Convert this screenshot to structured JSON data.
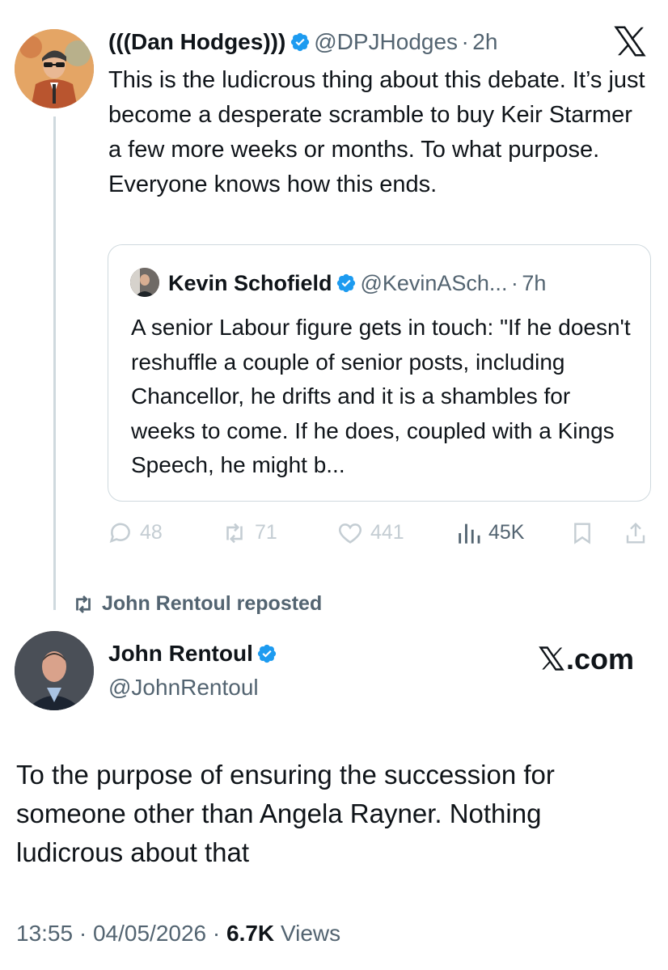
{
  "original_tweet": {
    "author_name": "(((Dan Hodges)))",
    "handle": "@DPJHodges",
    "separator": "·",
    "time_ago": "2h",
    "text": "This is the ludicrous thing about this debate. It’s just become a desperate scramble to buy Keir Starmer a few more weeks or months. To what purpose. Everyone knows how this ends.",
    "quoted_tweet": {
      "author_name": "Kevin Schofield",
      "handle": "@KevinASch...",
      "separator": "·",
      "time_ago": "7h",
      "text": "A senior Labour figure gets in touch: \"If he doesn't reshuffle a couple of senior posts, including Chancellor, he drifts and it is a shambles for weeks to come. If he does, coupled with a Kings Speech, he might b..."
    },
    "actions": {
      "replies": "48",
      "reposts": "71",
      "likes": "441",
      "views": "45K"
    }
  },
  "repost_banner": {
    "text": "John Rentoul reposted"
  },
  "reply_tweet": {
    "author_name": "John Rentoul",
    "handle": "@JohnRentoul",
    "brand": ".com",
    "text": "To the purpose of ensuring the succession for someone other than Angela Rayner. Nothing ludicrous about that",
    "time": "13:55",
    "date": "04/05/2026",
    "views_count": "6.7K",
    "views_label": "Views"
  },
  "icons": {
    "verified": "verified-badge-icon",
    "x_logo": "x-logo-icon",
    "reply": "reply-icon",
    "repost": "repost-icon",
    "like": "heart-icon",
    "views": "views-bars-icon",
    "bookmark": "bookmark-icon",
    "share": "share-icon"
  },
  "colors": {
    "verified_blue": "#1d9bf0",
    "text_primary": "#0f1419",
    "text_secondary": "#536471",
    "border": "#cfd9de",
    "action_faded": "#c4cdd3"
  }
}
